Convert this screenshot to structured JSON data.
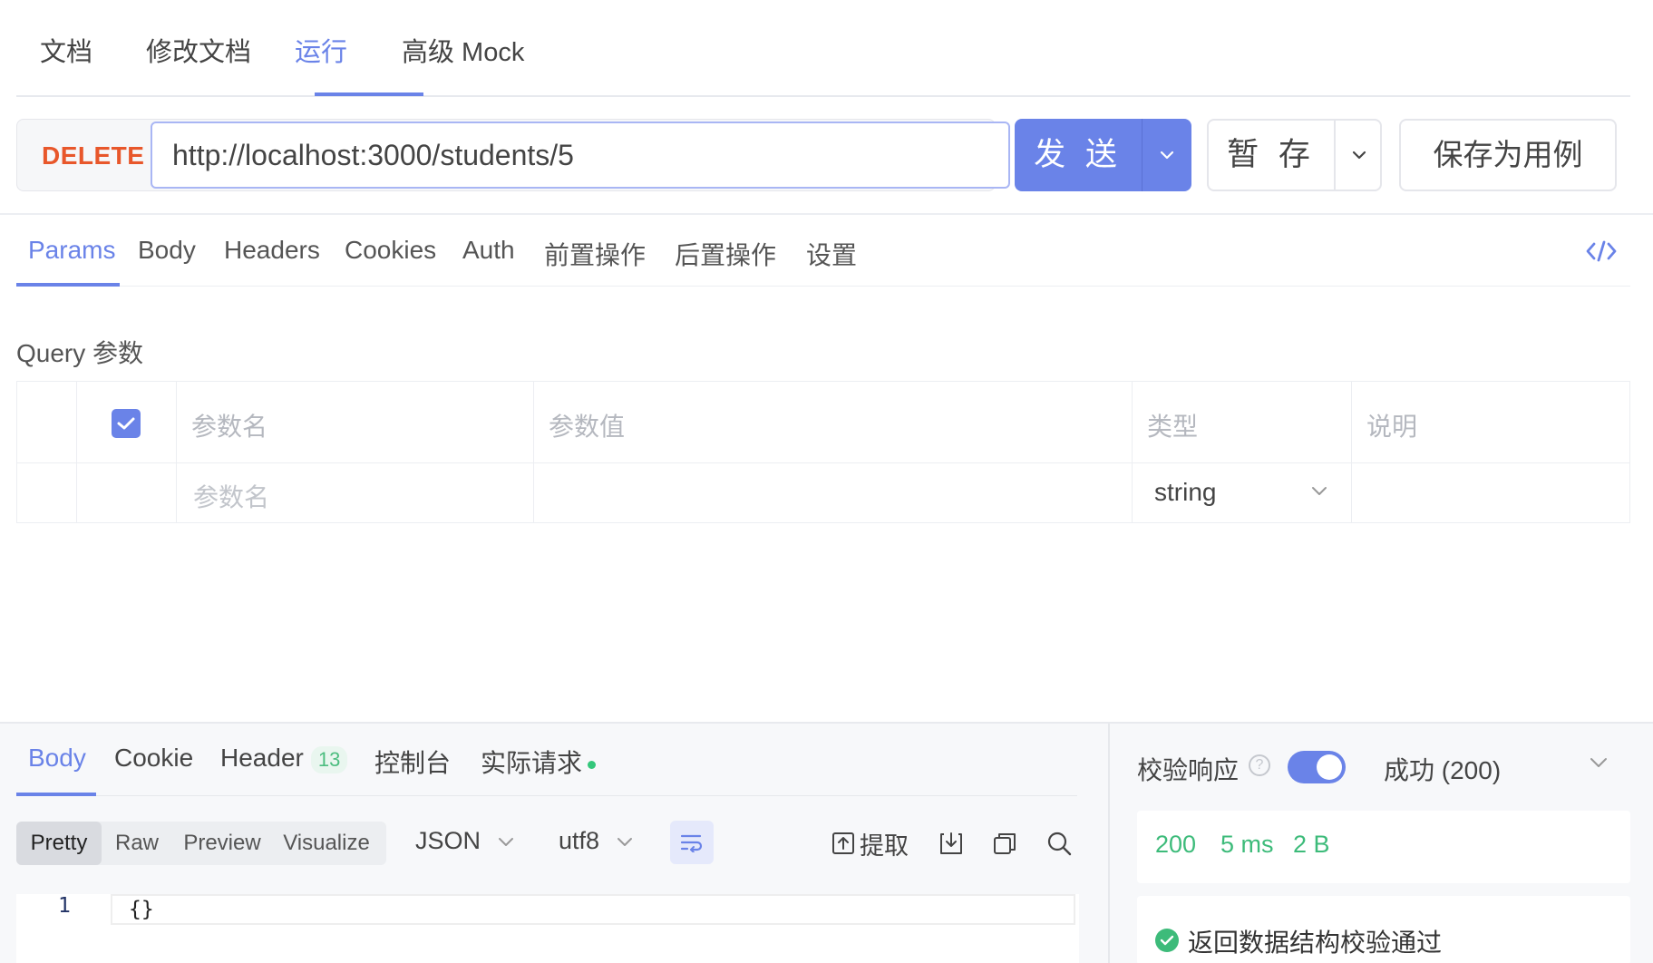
{
  "top_tabs": {
    "items": [
      {
        "label": "文档"
      },
      {
        "label": "修改文档"
      },
      {
        "label": "运行"
      },
      {
        "label": "高级 Mock"
      }
    ],
    "active": "运行"
  },
  "request": {
    "method": "DELETE",
    "url": "http://localhost:3000/students/5",
    "send_label": "发 送",
    "save_label": "暂 存",
    "save_case_label": "保存为用例"
  },
  "request_tabs": {
    "items": [
      {
        "label": "Params"
      },
      {
        "label": "Body"
      },
      {
        "label": "Headers"
      },
      {
        "label": "Cookies"
      },
      {
        "label": "Auth"
      },
      {
        "label": "前置操作"
      },
      {
        "label": "后置操作"
      },
      {
        "label": "设置"
      }
    ],
    "active": "Params"
  },
  "query": {
    "title": "Query 参数",
    "columns": {
      "name": "参数名",
      "value": "参数值",
      "type": "类型",
      "desc": "说明"
    },
    "rows": [
      {
        "name_placeholder": "参数名",
        "value": "",
        "type": "string",
        "desc": ""
      }
    ]
  },
  "response": {
    "tabs": [
      {
        "label": "Body"
      },
      {
        "label": "Cookie"
      },
      {
        "label": "Header",
        "badge": "13"
      },
      {
        "label": "控制台"
      },
      {
        "label": "实际请求"
      }
    ],
    "active": "Body",
    "view_modes": [
      "Pretty",
      "Raw",
      "Preview",
      "Visualize"
    ],
    "active_view": "Pretty",
    "format": "JSON",
    "encoding": "utf8",
    "extract_label": "提取",
    "code": {
      "line": "1",
      "text": "{}"
    }
  },
  "validation": {
    "label": "校验响应",
    "enabled": true,
    "result": "成功 (200)",
    "status_code": "200",
    "time": "5 ms",
    "size": "2 B",
    "message": "返回数据结构校验通过"
  },
  "colors": {
    "accent": "#6a83e8",
    "method_delete": "#e8572b",
    "success": "#3dbb7a"
  }
}
